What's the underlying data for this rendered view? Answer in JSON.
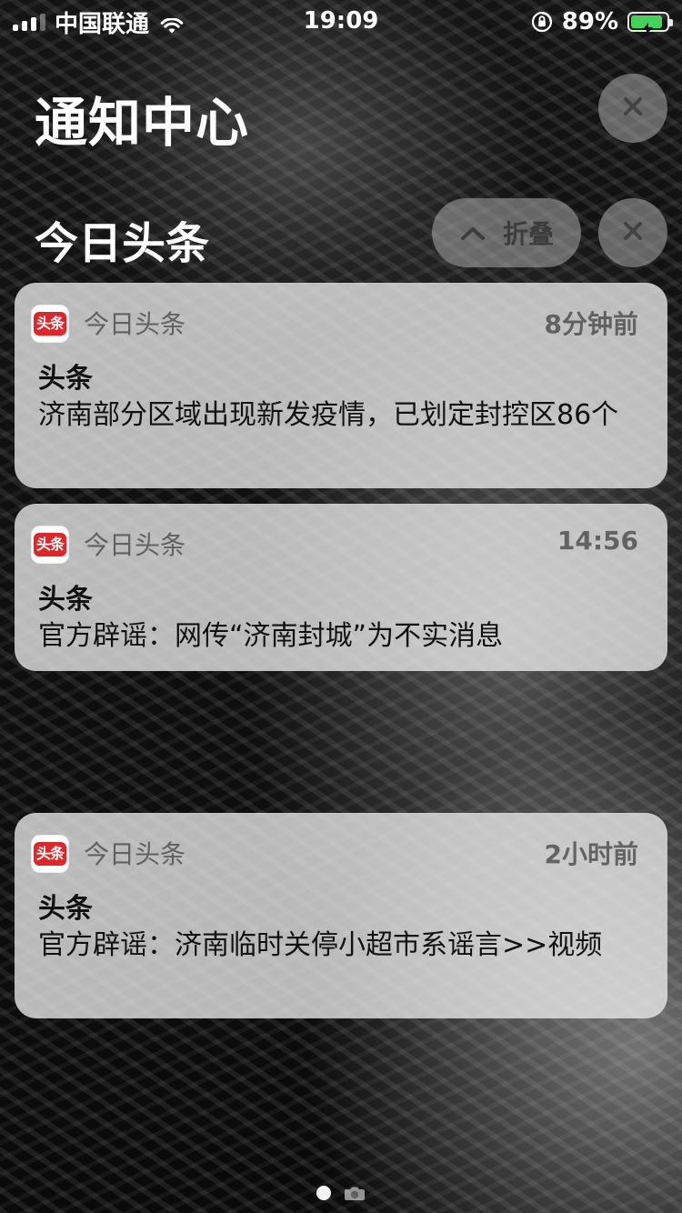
{
  "status_bar": {
    "carrier": "中国联通",
    "time": "19:09",
    "battery_percent": "89%",
    "battery_level": 0.89,
    "icons": {
      "signal": "signal-icon",
      "wifi": "wifi-icon",
      "orientation_lock": "orientation-lock-icon",
      "battery": "battery-icon",
      "charging": "charging-bolt-icon"
    },
    "colors": {
      "battery_green": "#44d35a"
    }
  },
  "header": {
    "title": "通知中心"
  },
  "group": {
    "title": "今日头条",
    "collapse_label": "折叠"
  },
  "notifications": [
    {
      "app_name": "今日头条",
      "app_icon_text": "头条",
      "time": "8分钟前",
      "title": "头条",
      "message": "济南部分区域出现新发疫情，已划定封控区86个"
    },
    {
      "app_name": "今日头条",
      "app_icon_text": "头条",
      "time": "14:56",
      "title": "头条",
      "message": "官方辟谣：网传“济南封城”为不实消息"
    },
    {
      "app_name": "今日头条",
      "app_icon_text": "头条",
      "time": "2小时前",
      "title": "头条",
      "message": "官方辟谣：济南临时关停小超市系谣言>>视频"
    }
  ],
  "colors": {
    "app_icon_red": "#e1262a"
  }
}
